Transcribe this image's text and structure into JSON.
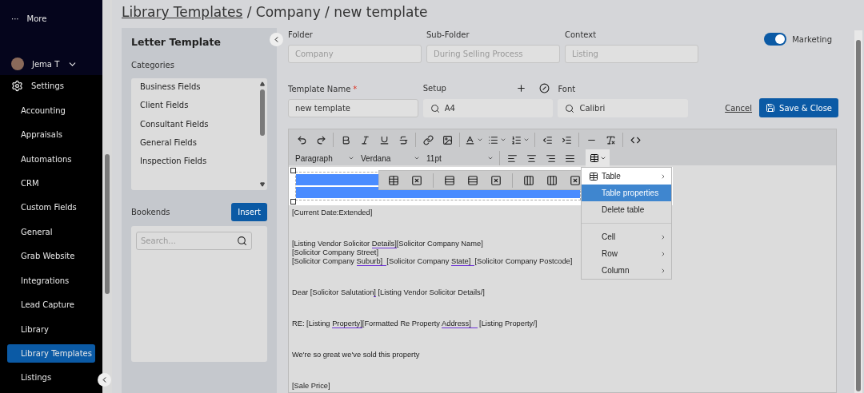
{
  "sidebar": {
    "more": {
      "icon": "···",
      "label": "More"
    },
    "user": {
      "name": "Jema T"
    },
    "section": {
      "label": "Settings"
    },
    "items": [
      {
        "label": "Accounting",
        "selected": false
      },
      {
        "label": "Appraisals",
        "selected": false
      },
      {
        "label": "Automations",
        "selected": false
      },
      {
        "label": "CRM",
        "selected": false
      },
      {
        "label": "Custom Fields",
        "selected": false
      },
      {
        "label": "General",
        "selected": false
      },
      {
        "label": "Grab Website",
        "selected": false
      },
      {
        "label": "Integrations",
        "selected": false
      },
      {
        "label": "Lead Capture",
        "selected": false
      },
      {
        "label": "Library",
        "selected": false
      },
      {
        "label": "Library Templates",
        "selected": true
      },
      {
        "label": "Listings",
        "selected": false
      }
    ]
  },
  "breadcrumb": {
    "link": "Library Templates",
    "rest": " / Company / new template"
  },
  "panel": {
    "title": "Letter Template",
    "categories_label": "Categories",
    "categories": [
      "Business Fields",
      "Client Fields",
      "Consultant Fields",
      "General Fields",
      "Inspection Fields"
    ],
    "bookends_label": "Bookends",
    "insert_button": "Insert",
    "search": {
      "placeholder": "Search..."
    }
  },
  "form": {
    "folder": {
      "label": "Folder",
      "value": "Company",
      "disabled": true
    },
    "sub_folder": {
      "label": "Sub-Folder",
      "value": "During Selling Process",
      "disabled": true
    },
    "context": {
      "label": "Context",
      "value": "Listing",
      "disabled": true
    },
    "marketing": {
      "label": "Marketing",
      "on": true
    },
    "template_name": {
      "label": "Template Name",
      "required": true,
      "required_mark": "*",
      "value": "new template",
      "disabled": false
    },
    "setup": {
      "label": "Setup",
      "value": "A4"
    },
    "font": {
      "label": "Font",
      "value": "Calibri"
    },
    "cancel": "Cancel",
    "save": "Save & Close"
  },
  "editor": {
    "block_format": "Paragraph",
    "font_family": "Verdana",
    "font_size": "11pt",
    "paragraphs": [
      [
        [
          {
            "text": "[Current Date:Extended]",
            "flagged": false
          }
        ]
      ],
      [
        [
          {
            "text": "[Listing Vendor Solicitor ",
            "flagged": false
          },
          {
            "text": "Details]",
            "flagged": true
          },
          {
            "text": "[Solicitor Company Name]",
            "flagged": false
          }
        ],
        [
          {
            "text": "[Solicitor Company Street]",
            "flagged": false
          }
        ],
        [
          {
            "text": "[Solicitor Company ",
            "flagged": false
          },
          {
            "text": "Suburb]  ",
            "flagged": true
          },
          {
            "text": "[Solicitor Company ",
            "flagged": false
          },
          {
            "text": "State]  ",
            "flagged": true
          },
          {
            "text": "[Solicitor Company Postcode]",
            "flagged": false
          }
        ]
      ],
      [
        [
          {
            "text": "Dear [Solicitor Salutation",
            "flagged": false
          },
          {
            "text": "]",
            "flagged": true
          },
          {
            "text": " [Listing Vendor Solicitor Details/]",
            "flagged": false
          }
        ]
      ],
      [
        [
          {
            "text": "RE: [Listing ",
            "flagged": false
          },
          {
            "text": "Property]",
            "flagged": true
          },
          {
            "text": "[Formatted Re Property ",
            "flagged": false
          },
          {
            "text": "Address]   ",
            "flagged": true
          },
          {
            "text": " [Listing Property/]",
            "flagged": false
          }
        ]
      ],
      [
        [
          {
            "text": "We're so great we've sold this property",
            "flagged": false
          }
        ]
      ],
      [
        [
          {
            "text": "[Sale Price]",
            "flagged": false
          }
        ]
      ]
    ],
    "context_menu": [
      [
        {
          "label": "Table",
          "kind": "icon-submenu",
          "selected": false,
          "spotlit": true
        },
        {
          "label": "Table properties",
          "kind": "action",
          "selected": true,
          "spotlit": true
        },
        {
          "label": "Delete table",
          "kind": "action",
          "selected": false,
          "spotlit": false
        }
      ],
      [
        {
          "label": "Cell",
          "kind": "submenu",
          "selected": false,
          "spotlit": false
        },
        {
          "label": "Row",
          "kind": "submenu",
          "selected": false,
          "spotlit": false
        },
        {
          "label": "Column",
          "kind": "submenu",
          "selected": false,
          "spotlit": false
        }
      ]
    ]
  }
}
